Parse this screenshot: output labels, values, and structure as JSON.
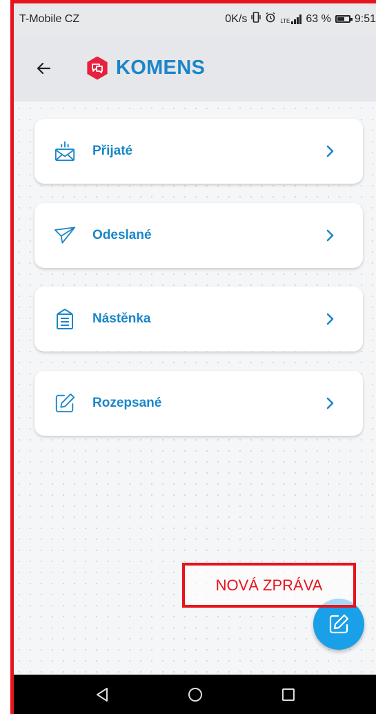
{
  "status_bar": {
    "carrier": "T-Mobile CZ",
    "speed": "0K/s",
    "network": "LTE",
    "battery_percent": "63 %",
    "battery_level": 0.63,
    "time": "9:51",
    "icons": [
      "vibrate-icon",
      "alarm-icon",
      "signal-icon",
      "battery-icon"
    ]
  },
  "app_bar": {
    "back_icon": "arrow-left-icon",
    "logo_icon": "chat-bubble-icon",
    "title": "KOMENS"
  },
  "menu": {
    "items": [
      {
        "label": "Přijaté",
        "icon": "inbox-envelope-icon"
      },
      {
        "label": "Odeslané",
        "icon": "paper-plane-icon"
      },
      {
        "label": "Nástěnka",
        "icon": "noticeboard-icon"
      },
      {
        "label": "Rozepsané",
        "icon": "edit-draft-icon"
      }
    ],
    "chevron_icon": "chevron-right-icon"
  },
  "annotation": {
    "label": "NOVÁ ZPRÁVA"
  },
  "fab": {
    "icon": "compose-icon"
  },
  "nav_bar": {
    "icons": [
      "back-triangle-icon",
      "home-circle-icon",
      "recents-square-icon"
    ]
  },
  "colors": {
    "accent": "#1a86c8",
    "fab": "#1aa0e8",
    "logo": "#e5213e",
    "annotation": "#e8141c",
    "app_bar_bg": "#e5e7ea",
    "page_bg": "#f5f6f8"
  }
}
